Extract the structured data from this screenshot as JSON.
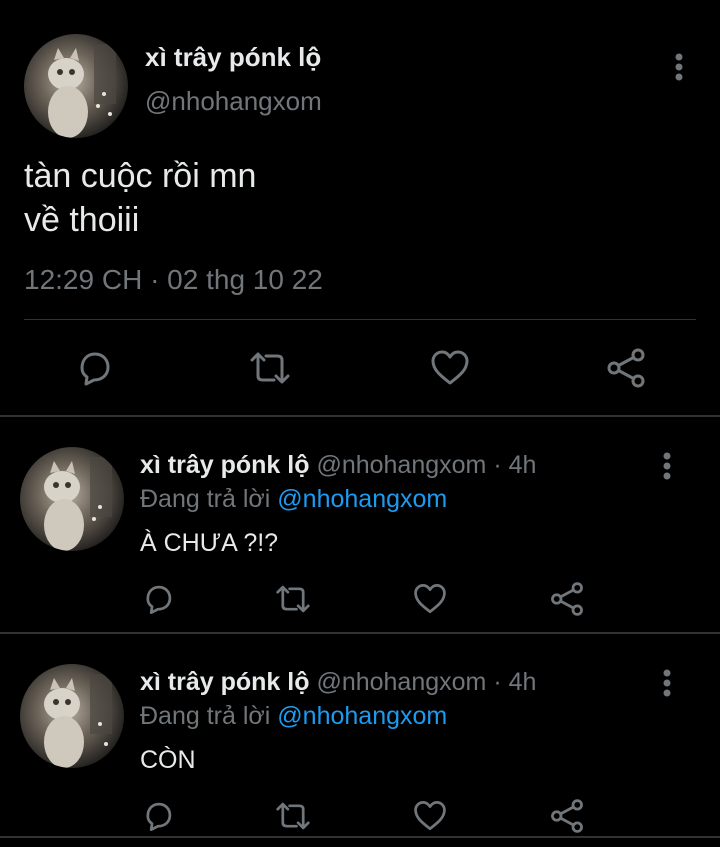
{
  "main_tweet": {
    "author_name": "xì trây pónk lộ",
    "author_handle": "@nhohangxom",
    "text": "tàn cuộc rồi mn\nvề thoiii",
    "timestamp": "12:29 CH · 02 thg 10 22",
    "actions": [
      "reply-icon",
      "retweet-icon",
      "like-icon",
      "share-icon"
    ],
    "more_icon": "more-vertical-icon"
  },
  "replies": [
    {
      "author_name": "xì trây pónk lộ",
      "author_handle": "@nhohangxom",
      "time": "· 4h",
      "replying_prefix": "Đang trả lời",
      "replying_to": "@nhohangxom",
      "text": "À CHƯA ?!?"
    },
    {
      "author_name": "xì trây pónk lộ",
      "author_handle": "@nhohangxom",
      "time": "· 4h",
      "replying_prefix": "Đang trả lời",
      "replying_to": "@nhohangxom",
      "text": "CÒN"
    }
  ],
  "colors": {
    "background": "#000000",
    "text_primary": "#e7e9ea",
    "text_secondary": "#71767b",
    "link": "#1d9bf0",
    "divider": "#2f3336"
  }
}
